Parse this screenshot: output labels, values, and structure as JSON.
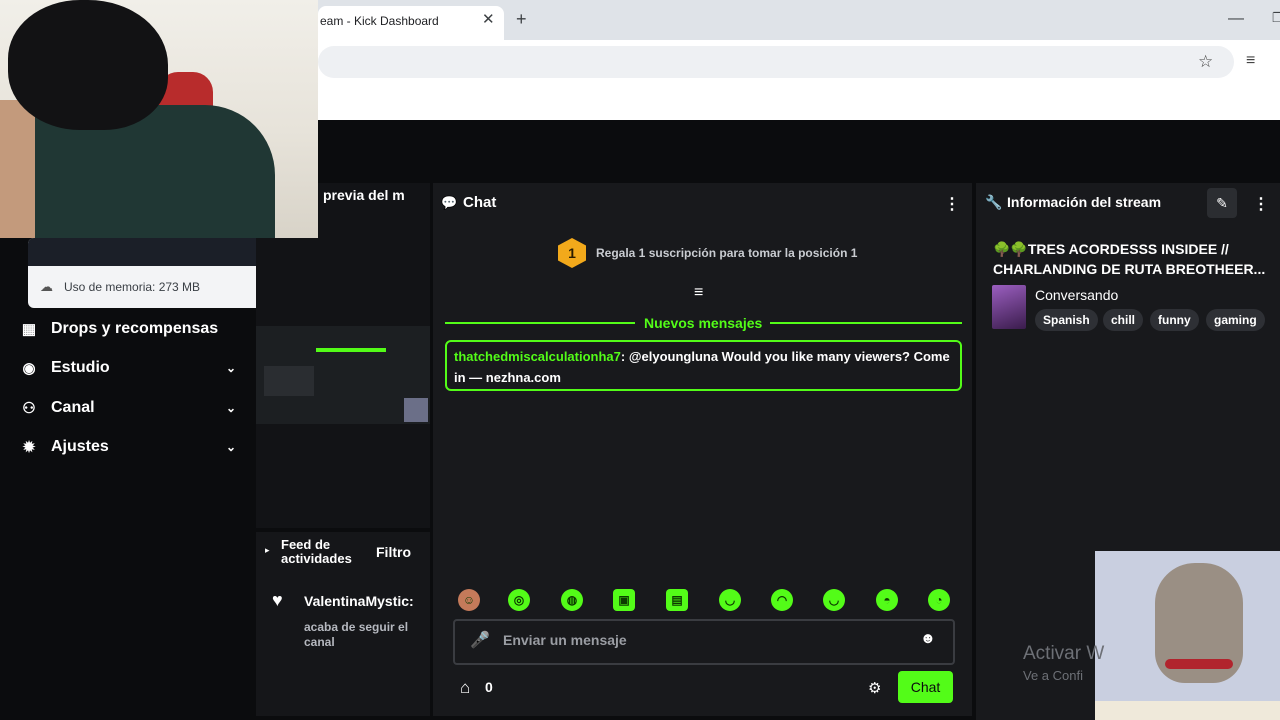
{
  "browser": {
    "tab_title": "eam - Kick Dashboard",
    "close_symbol": "✕",
    "new_tab_symbol": "+",
    "minimize_symbol": "—",
    "maximize_symbol": "❐",
    "star_icon": "☆",
    "media_icon": "≡"
  },
  "memory_popup": {
    "icon": "☁",
    "text": "Uso de memoria: 273 MB"
  },
  "sidebar": {
    "items": [
      {
        "label": "Drops y recompensas",
        "icon": "▦",
        "chevron": ""
      },
      {
        "label": "Estudio",
        "icon": "◉",
        "chevron": "⌄"
      },
      {
        "label": "Canal",
        "icon": "⚇",
        "chevron": "⌄"
      },
      {
        "label": "Ajustes",
        "icon": "✹",
        "chevron": "⌄"
      }
    ]
  },
  "preview": {
    "title": "previa del m"
  },
  "feed": {
    "title": "Feed de actividades",
    "filter": "Filtro",
    "chevron": "▸",
    "heart_icon": "♥",
    "username": "ValentinaMystic:",
    "action": "acaba de seguir el canal"
  },
  "chat": {
    "title": "Chat",
    "icon": "💬",
    "more_icon": "⋮",
    "gift_rank": "1",
    "gift_text": "Regala 1 suscripción para tomar la posición 1",
    "scroll_icon": "≡",
    "new_messages": "Nuevos mensajes",
    "message": {
      "user": "thatchedmiscalculationha7",
      "text": ": @elyoungluna Would you like many viewers? Come in — nezhna.com"
    },
    "emotes": [
      "☺",
      "◎",
      "◍",
      "▣",
      "▤",
      "◡",
      "◠",
      "◡",
      "◓",
      "◔",
      "◕"
    ],
    "mic_icon": "🎤",
    "placeholder": "Enviar un mensaje",
    "emoji_icon": "☻",
    "store_icon": "⌂",
    "points": "0",
    "gear_icon": "⚙",
    "send_label": "Chat"
  },
  "stream_info": {
    "icon": "🔧",
    "title": "Información del stream",
    "edit_icon": "✎",
    "more_icon": "⋮",
    "stream_title": "🌳🌳TRES ACORDESSS INSIDEE // CHARLANDING DE RUTA BREOTHEER...",
    "category": "Conversando",
    "tags": [
      "Spanish",
      "chill",
      "funny",
      "gaming"
    ]
  },
  "watermark": {
    "title": "Activar W",
    "subtitle": "Ve a Confi"
  },
  "colors": {
    "accent": "#53fc18",
    "panel": "#18191c",
    "background": "#0b0c0e"
  }
}
